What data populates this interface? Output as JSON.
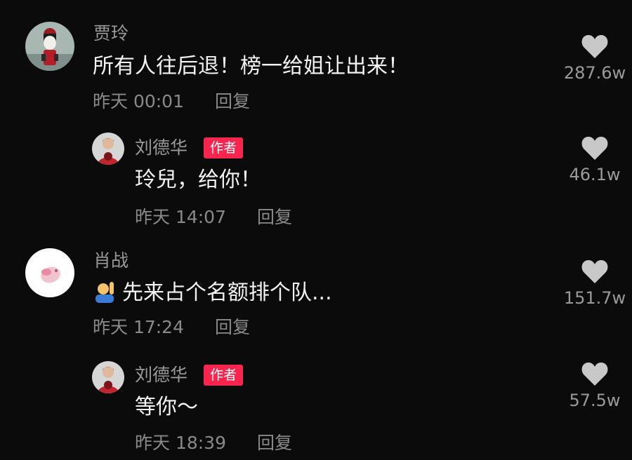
{
  "comments": [
    {
      "user": "贾玲",
      "text": "所有人往后退！榜一给姐让出来！",
      "time": "昨天 00:01",
      "reply_label": "回复",
      "likes": "287.6w",
      "avatar_icon": "cartoon-girl-avatar"
    },
    {
      "user": "刘德华",
      "badge": "作者",
      "text": "玲兒，给你！",
      "time": "昨天 14:07",
      "reply_label": "回复",
      "likes": "46.1w",
      "avatar_icon": "man-portrait-avatar"
    },
    {
      "user": "肖战",
      "emoji": "person-raising-hand-emoji",
      "text": "先来占个名额排个队...",
      "time": "昨天 17:24",
      "reply_label": "回复",
      "likes": "151.7w",
      "avatar_icon": "pink-bird-avatar"
    },
    {
      "user": "刘德华",
      "badge": "作者",
      "text": "等你～",
      "time": "昨天 18:39",
      "reply_label": "回复",
      "likes": "57.5w",
      "avatar_icon": "man-portrait-avatar"
    }
  ],
  "colors": {
    "background": "#0b0b0b",
    "badge": "#f8264f",
    "heart": "#c8c8c8"
  }
}
